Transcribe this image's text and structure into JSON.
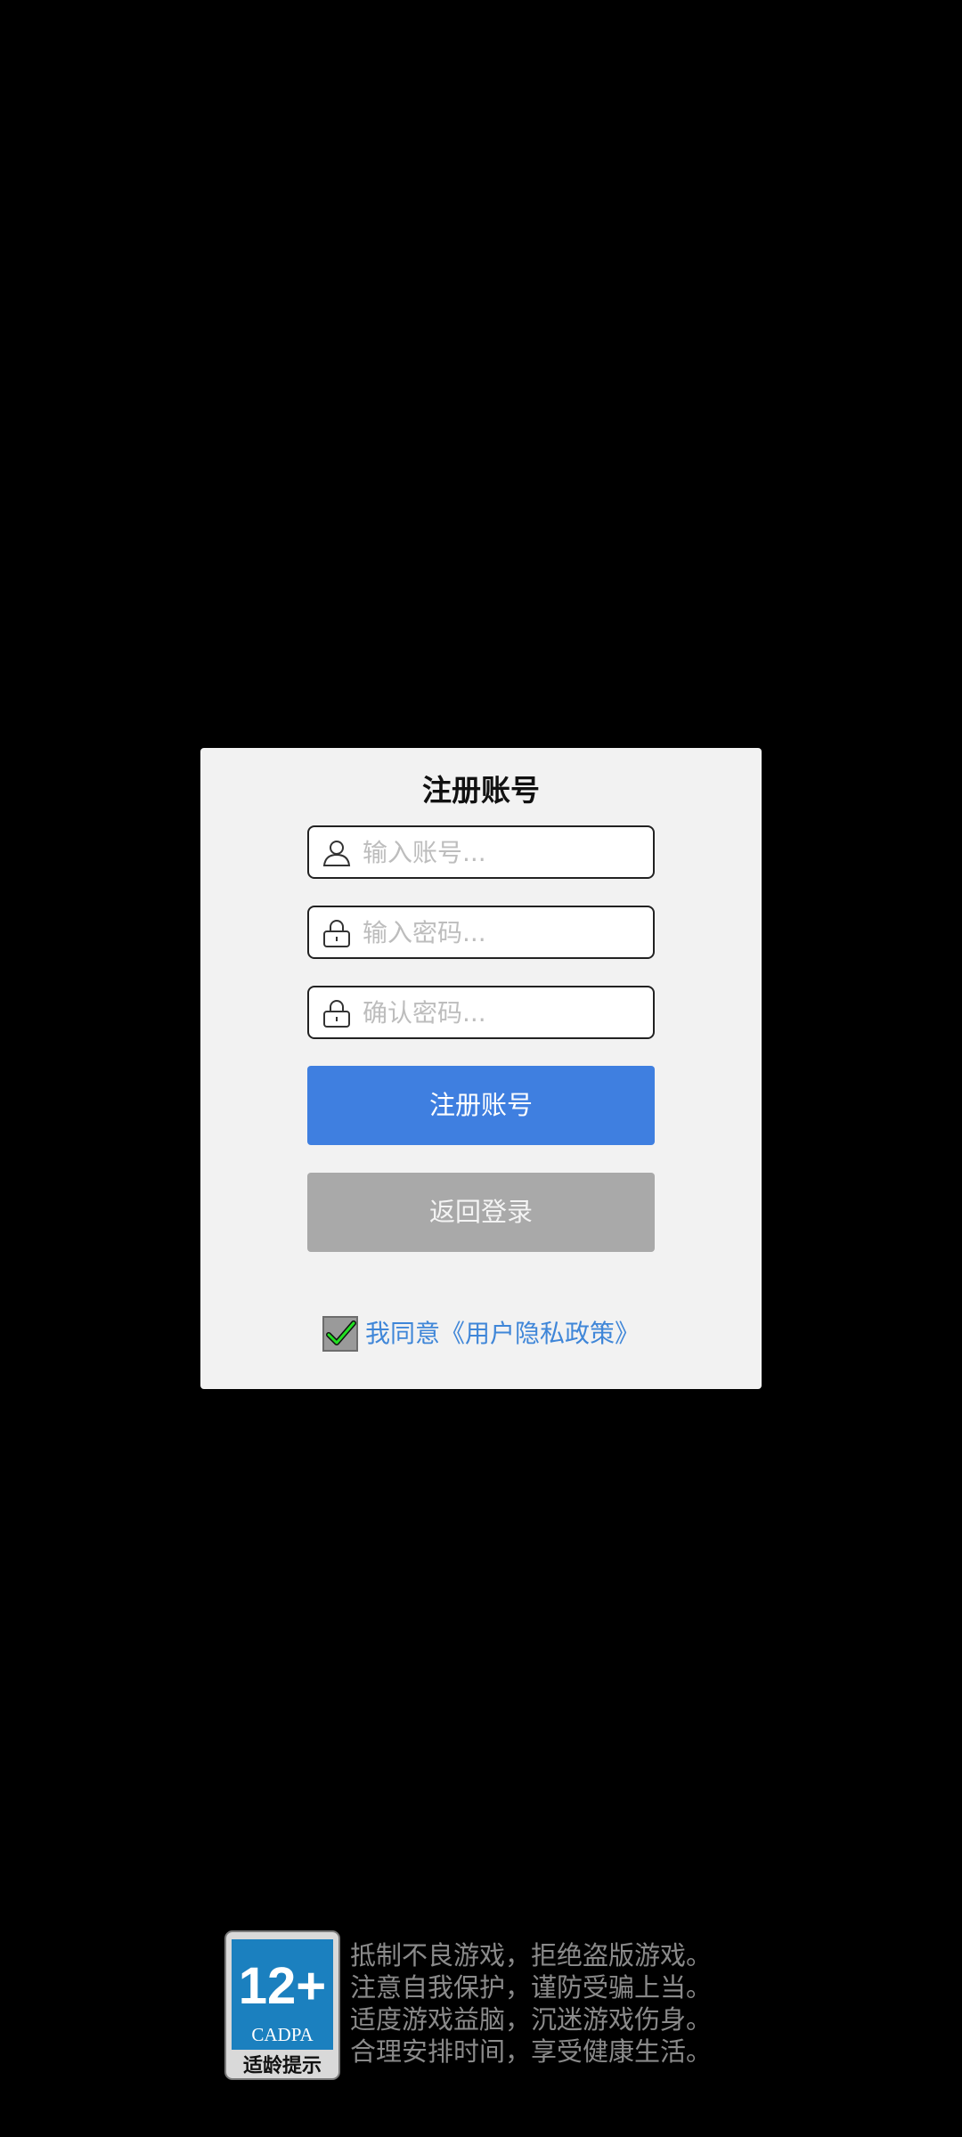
{
  "dialog": {
    "title": "注册账号",
    "account": {
      "placeholder": "输入账号...",
      "value": ""
    },
    "password": {
      "placeholder": "输入密码...",
      "value": ""
    },
    "confirm_password": {
      "placeholder": "确认密码...",
      "value": ""
    },
    "register_button": "注册账号",
    "back_button": "返回登录",
    "agreement": {
      "checked": true,
      "text": "我同意《用户隐私政策》"
    }
  },
  "age_rating": {
    "rating": "12+",
    "org": "CADPA",
    "label": "适龄提示"
  },
  "health_notice": [
    "抵制不良游戏，拒绝盗版游戏。",
    "注意自我保护，谨防受骗上当。",
    "适度游戏益脑，沉迷游戏伤身。",
    "合理安排时间，享受健康生活。"
  ],
  "colors": {
    "background": "#000000",
    "dialog_bg": "#f2f2f2",
    "primary": "#3f7fe0",
    "secondary": "#a9a9a9",
    "link": "#3f86d8",
    "badge_blue": "#1b80bf"
  }
}
